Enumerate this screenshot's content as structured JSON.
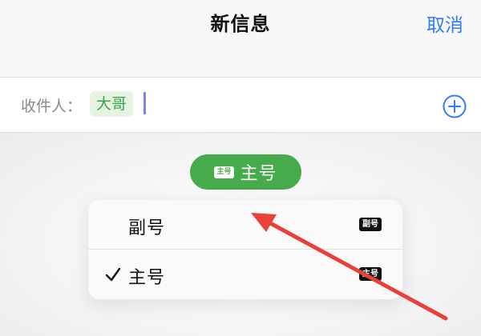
{
  "header": {
    "title": "新信息",
    "cancel_label": "取消"
  },
  "to_row": {
    "label": "收件人：",
    "recipient": "大哥",
    "add_icon": "plus-circle-icon"
  },
  "line_pill": {
    "badge": "主号",
    "label": "主号"
  },
  "menu": {
    "items": [
      {
        "label": "副号",
        "badge": "副号",
        "checked": false
      },
      {
        "label": "主号",
        "badge": "主号",
        "checked": true
      }
    ]
  },
  "colors": {
    "accent_blue": "#2f7cf6",
    "pill_green": "#46ab4a",
    "chip_green_text": "#3aa64a",
    "annotation_red": "#e8413a"
  },
  "icons": {
    "check": "checkmark-icon",
    "arrow": "red-annotation-arrow"
  }
}
